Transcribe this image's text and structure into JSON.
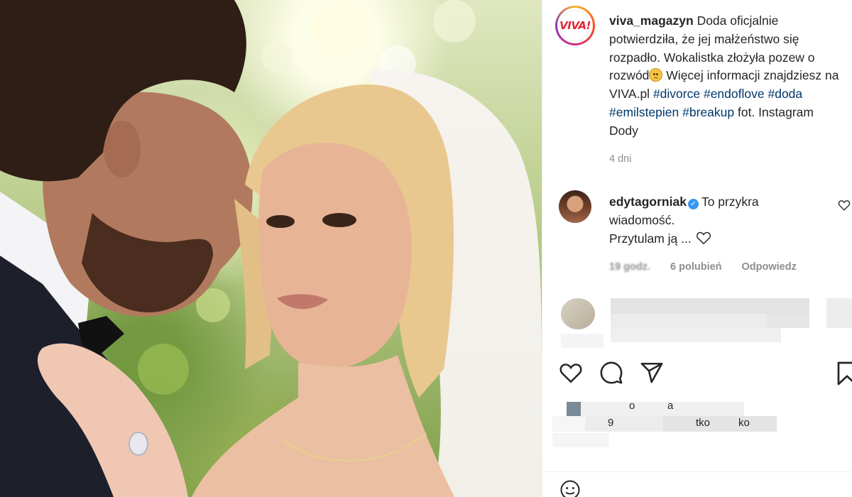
{
  "post": {
    "username": "viva_magazyn",
    "avatar_text": "VIVA!",
    "caption_line_1": "Doda oficjalnie potwierdziła, że jej małżeństwo się rozpadło. Wokalistka złożyła pozew o rozwód",
    "caption_line_2": " Więcej informacji znajdziesz na VIVA.pl ",
    "hashtags": [
      "#divorce",
      "#endoflove",
      "#doda",
      "#emilstepien",
      "#breakup"
    ],
    "caption_tail": " fot. Instagram Dody",
    "time_ago": "4 dni"
  },
  "comment": {
    "username": "edytagorniak",
    "text_1": "To przykra wiadomość.",
    "text_2": "Przytulam ją ...",
    "meta_time": "19 godz.",
    "meta_likes": "6 polubień",
    "meta_reply": "Odpowiedz"
  },
  "likes_partial": {
    "frag_o": "o",
    "frag_a": "a",
    "frag_9": "9",
    "frag_tko": "tko",
    "frag_ko": "ko"
  },
  "icons": {
    "like": "heart-icon",
    "comment": "comment-icon",
    "share": "share-icon",
    "save": "bookmark-icon",
    "emoji": "emoji-icon",
    "verified": "verified-icon"
  },
  "colors": {
    "text": "#262626",
    "secondary": "#8e8e8e",
    "hashtag": "#00376b",
    "verified": "#3897f0",
    "viva_red": "#e32636"
  }
}
